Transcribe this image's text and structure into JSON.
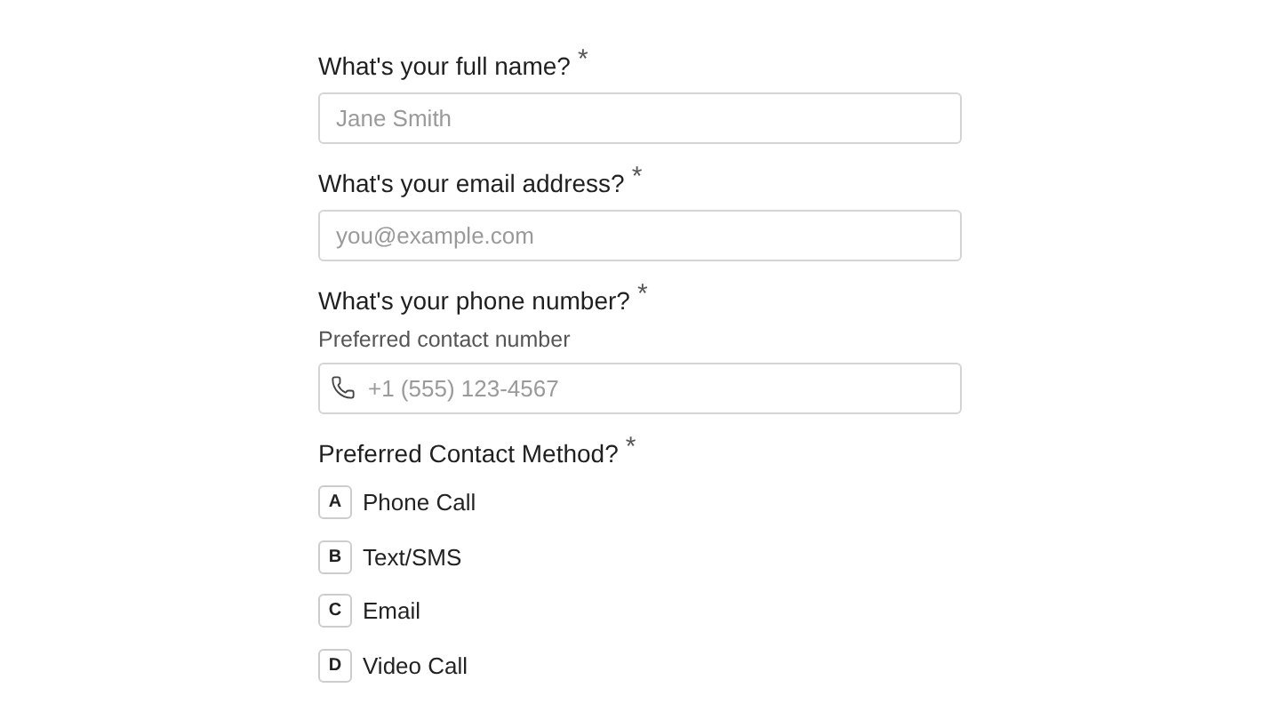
{
  "fields": [
    {
      "label": "What's your full name?",
      "required_mark": "*",
      "placeholder": "Jane Smith"
    },
    {
      "label": "What's your email address?",
      "required_mark": "*",
      "placeholder": "you@example.com"
    },
    {
      "label": "What's your phone number?",
      "required_mark": "*",
      "hint": "Preferred contact number",
      "placeholder": "+1 (555) 123-4567",
      "kind": "phone"
    }
  ],
  "choice": {
    "label": "Preferred Contact Method?",
    "required_mark": "*",
    "options": [
      {
        "key": "A",
        "label": "Phone Call",
        "selected": false
      },
      {
        "key": "B",
        "label": "Text/SMS",
        "selected": false
      },
      {
        "key": "C",
        "label": "Email",
        "selected": false
      },
      {
        "key": "D",
        "label": "Video Call",
        "selected": false
      }
    ]
  }
}
